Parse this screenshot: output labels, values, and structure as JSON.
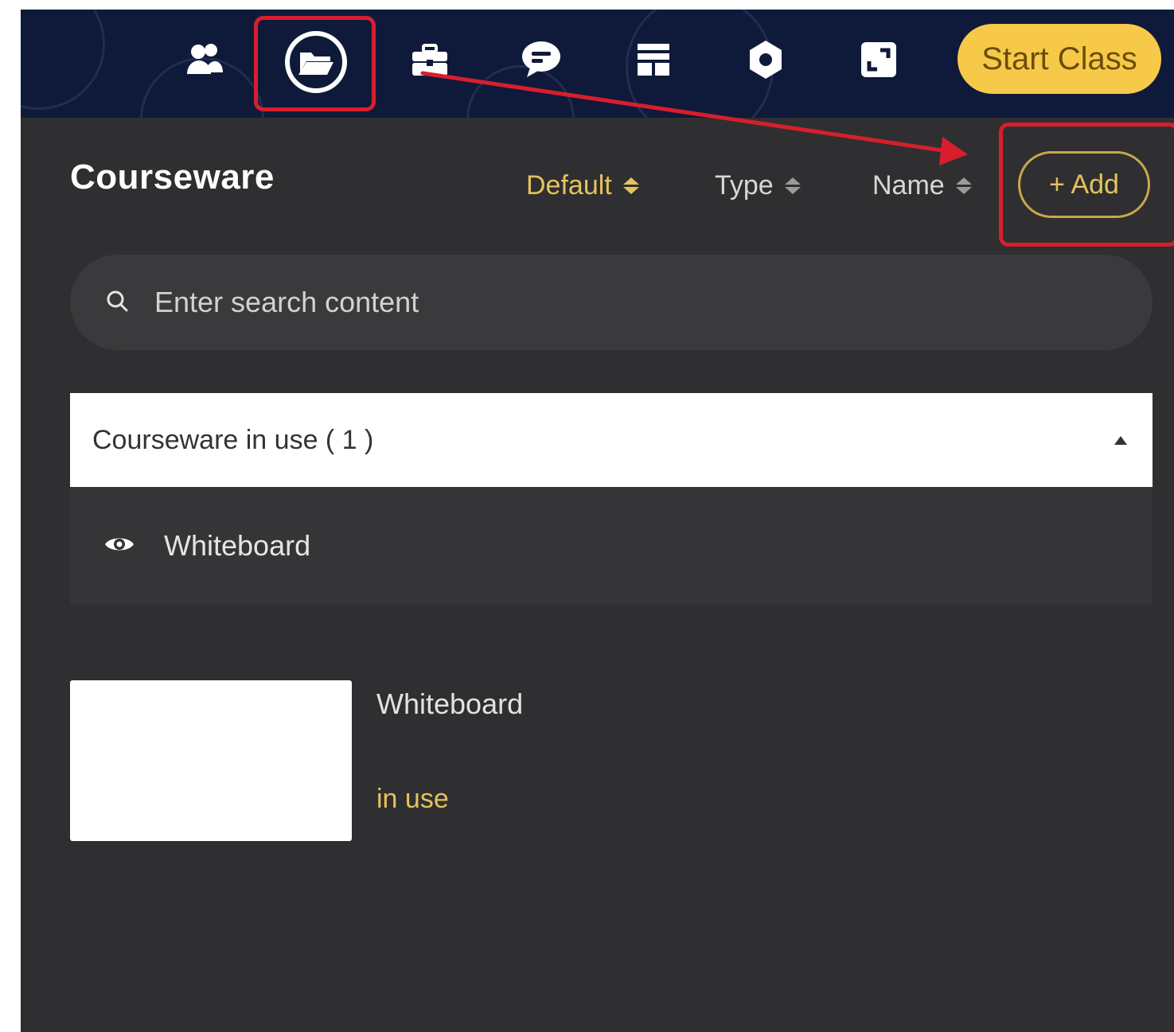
{
  "toolbar": {
    "icons": [
      "users-icon",
      "folder-open-icon",
      "toolbox-icon",
      "chat-icon",
      "layout-icon",
      "gear-icon",
      "fullscreen-icon"
    ],
    "start_button_label": "Start Class"
  },
  "panel": {
    "title": "Courseware",
    "sort_options": [
      {
        "label": "Default",
        "active": true
      },
      {
        "label": "Type",
        "active": false
      },
      {
        "label": "Name",
        "active": false
      }
    ],
    "add_button_label": "+ Add",
    "search": {
      "placeholder": "Enter search content",
      "value": ""
    },
    "section": {
      "label": "Courseware in use ( 1 )",
      "expanded": true,
      "items": [
        {
          "name": "Whiteboard",
          "icon": "eye-icon"
        }
      ]
    },
    "cards": [
      {
        "title": "Whiteboard",
        "status": "in use"
      }
    ]
  },
  "colors": {
    "toolbar_bg": "#0f1a3a",
    "panel_bg": "#2f2f31",
    "accent": "#e6c25c",
    "start_button": "#f7c948",
    "annotation": "#d81e2c"
  }
}
